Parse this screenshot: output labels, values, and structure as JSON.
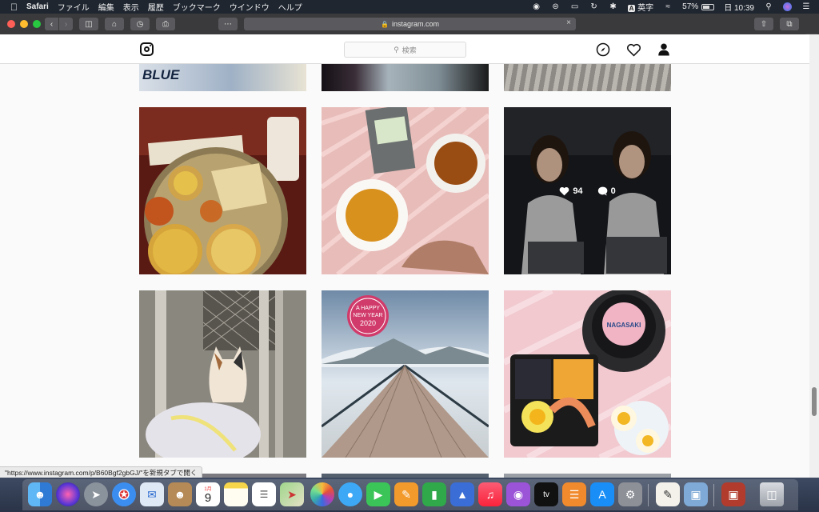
{
  "menubar": {
    "apple_icon": "apple-icon",
    "app_name": "Safari",
    "menus": [
      "ファイル",
      "編集",
      "表示",
      "履歴",
      "ブックマーク",
      "ウインドウ",
      "ヘルプ"
    ],
    "input_badge": "A",
    "input_label": "英字",
    "battery": "57%",
    "clock": "日 10:39"
  },
  "safari": {
    "address": "instagram.com",
    "lock_icon": "lock-icon"
  },
  "instagram": {
    "search_placeholder": "検索",
    "hover_likes": "94",
    "hover_comments": "0",
    "hover_tile_index": 5,
    "tile_texts": {
      "partial_tile_text": "BLUE",
      "new_year_line1": "A HAPPY",
      "new_year_line2": "NEW YEAR",
      "new_year_line3": "2020",
      "bento_label": "NAGASAKI"
    }
  },
  "status_bar": {
    "url_hint": "\"https://www.instagram.com/p/B60Bgf2gbGJ/\"を新規タブで開く"
  },
  "dock": {
    "calendar_day": "9",
    "calendar_month": "1月",
    "tv_label": "tv",
    "apps": [
      "Finder",
      "Siri",
      "Launchpad",
      "Safari",
      "Mail",
      "Contacts",
      "Calendar",
      "Notes",
      "Reminders",
      "Maps",
      "Photos",
      "Messages",
      "FaceTime",
      "Pages",
      "Numbers",
      "Keynote",
      "Music",
      "Podcasts",
      "TV",
      "Books",
      "App Store",
      "System Preferences",
      "TextEdit",
      "Preview",
      "Photo Booth",
      "Trash"
    ]
  }
}
